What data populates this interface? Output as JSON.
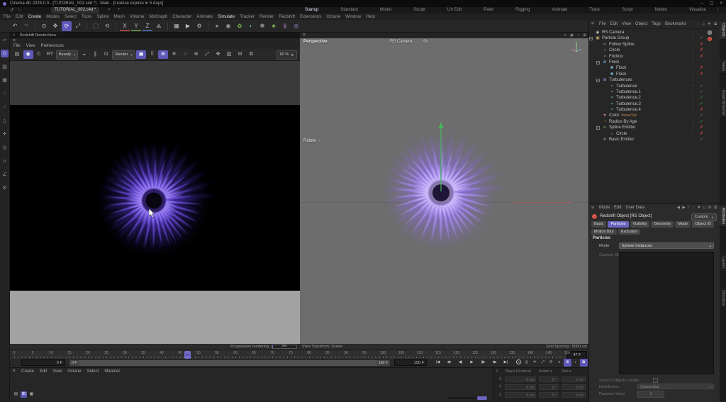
{
  "colors": {
    "accent": "#6c66c4",
    "check_green": "#4fae53",
    "cross_red": "#cf4a42",
    "rs_tag_red": "#c23c34",
    "viewport_gray": "#6d6d6d"
  },
  "window": {
    "title": "Cinema 4D 2025.0.0 - [TUTORIAL_002.c4d *] - Main - [License expires in 5 days]",
    "controls": [
      {
        "name": "minimize-button",
        "glyph": "–"
      },
      {
        "name": "maximize-button",
        "glyph": "▢"
      },
      {
        "name": "close-button",
        "glyph": "×"
      }
    ]
  },
  "document_bar": {
    "back": "↺",
    "forward": "↻",
    "tab_label": "TUTORIAL_002.c4d *",
    "tab_close": "×",
    "tab_add": "+",
    "overflow": "⋮"
  },
  "layout_tabs": {
    "active": "Startup",
    "items": [
      "Startup",
      "Standard",
      "Model",
      "Sculpt",
      "UV Edit",
      "Paint",
      "Rigging",
      "Animate",
      "Track",
      "Script",
      "Nodes",
      "Visualize"
    ]
  },
  "menu_bar": {
    "items": [
      "File",
      "Edit",
      "Create",
      "Modes",
      "Select",
      "Tools",
      "Spline",
      "Mesh",
      "Volume",
      "MoGraph",
      "Character",
      "Animate",
      "Simulate",
      "Tracker",
      "Render",
      "Redshift",
      "Extensions",
      "Octane",
      "Window",
      "Help"
    ],
    "emphasized": [
      "Create",
      "Simulate"
    ]
  },
  "main_toolbar": {
    "icons": [
      {
        "name": "undo-icon",
        "glyph": "↶"
      },
      {
        "name": "redo-icon",
        "glyph": "↷",
        "dim": true
      },
      {
        "sep": true
      },
      {
        "name": "live-selection-icon",
        "glyph": "⊙"
      },
      {
        "name": "move-icon",
        "glyph": "✥"
      },
      {
        "name": "rotate-icon",
        "glyph": "⟳",
        "active": true
      },
      {
        "name": "scale-icon",
        "glyph": "⤢"
      },
      {
        "sep": true
      },
      {
        "name": "last-tool-icon",
        "glyph": "◯",
        "dim": true
      },
      {
        "name": "coordinate-system-icon",
        "glyph": "⟲"
      },
      {
        "sep": true
      },
      {
        "name": "lock-x-axis-icon",
        "glyph": "X",
        "underline": "#c4504e"
      },
      {
        "name": "lock-y-axis-icon",
        "glyph": "Y",
        "underline": "#69a84f"
      },
      {
        "name": "lock-z-axis-icon",
        "glyph": "Z",
        "underline": "#5575c9"
      },
      {
        "name": "workplane-icon",
        "glyph": "⟁"
      },
      {
        "sep": true
      },
      {
        "name": "render-view-icon",
        "glyph": "▦"
      },
      {
        "name": "render-picture-viewer-icon",
        "glyph": "▶"
      },
      {
        "name": "render-settings-icon",
        "glyph": "⚙"
      },
      {
        "sep": true
      },
      {
        "name": "new-material-icon",
        "glyph": "●",
        "color": "#8f8f8f"
      },
      {
        "name": "edit-material-icon",
        "glyph": "◉",
        "color": "#9f9f9f"
      },
      {
        "name": "simulation-scene-icon",
        "glyph": "✿",
        "color": "#7cb24c"
      },
      {
        "name": "cloth-icon",
        "glyph": "◐",
        "color": "#58a87c"
      },
      {
        "name": "rigid-body-icon",
        "glyph": "✽",
        "color": "#9a9a9a"
      },
      {
        "name": "particles-icon",
        "glyph": "♣",
        "color": "#7cb24c"
      },
      {
        "name": "field-icon",
        "glyph": "ϕ",
        "color": "#b07cc9"
      },
      {
        "name": "volume-icon",
        "glyph": "◎",
        "color": "#8a9ad0"
      }
    ]
  },
  "left_toolbar": {
    "icons": [
      {
        "name": "make-editable-icon",
        "glyph": "▱"
      },
      {
        "name": "model-mode-icon",
        "glyph": "◇",
        "active": true
      },
      {
        "name": "texture-mode-icon",
        "glyph": "▨"
      },
      {
        "name": "workplane-mode-icon",
        "glyph": "▦"
      },
      {
        "name": "points-mode-icon",
        "glyph": "∴"
      },
      {
        "name": "edges-mode-icon",
        "glyph": "∕"
      },
      {
        "name": "polygons-mode-icon",
        "glyph": "△"
      },
      {
        "name": "enable-axis-icon",
        "glyph": "✛"
      },
      {
        "name": "viewport-solo-icon",
        "glyph": "◎"
      },
      {
        "name": "snap-icon",
        "glyph": "∪"
      },
      {
        "name": "quantize-icon",
        "glyph": "∠"
      },
      {
        "name": "modeling-settings-icon",
        "glyph": "⚙"
      }
    ]
  },
  "renderview": {
    "tab_close": "×",
    "title": "Redshift RenderView",
    "hamburger": "≡",
    "menus": [
      "File",
      "View",
      "Preferences"
    ],
    "icons": [
      {
        "name": "snapshot-icon",
        "glyph": "▤"
      },
      {
        "name": "camera-lock-icon",
        "glyph": "◉",
        "active": true
      },
      {
        "name": "restart-render-icon",
        "glyph": "C"
      },
      {
        "name": "rt-toggle",
        "glyph": "RT"
      },
      {
        "name": "aov-select",
        "dropdown": "Beauty"
      },
      {
        "name": "display-filter-icon",
        "glyph": "◒",
        "caret": true
      },
      {
        "name": "pause-icon",
        "glyph": "∥"
      },
      {
        "name": "region-icon",
        "glyph": "⊡"
      },
      {
        "name": "render-select",
        "dropdown": "Render"
      },
      {
        "name": "bucket-render-icon",
        "glyph": "▣",
        "active": true
      },
      {
        "name": "progressive-grid-icon",
        "glyph": "⠿"
      },
      {
        "name": "pixel-match-icon",
        "glyph": "⊞",
        "active": true
      },
      {
        "name": "freeze-icon",
        "glyph": "❄"
      },
      {
        "name": "background-icon",
        "glyph": "○",
        "caret": true
      },
      {
        "name": "focus-icon",
        "glyph": "⊕"
      },
      {
        "name": "fit-view-icon",
        "glyph": "⤢"
      },
      {
        "name": "pan-view-icon",
        "glyph": "✥"
      },
      {
        "name": "compare-icon",
        "glyph": "▥"
      },
      {
        "name": "save-image-icon",
        "glyph": "⊟"
      },
      {
        "name": "copy-image-icon",
        "glyph": "⧉"
      }
    ],
    "zoom_value": "60 %",
    "zoom_spin": "⇅"
  },
  "viewport": {
    "hamburger": "≡",
    "right_icons": [
      {
        "name": "display-mode-icon",
        "glyph": "◐"
      },
      {
        "name": "camera-icon",
        "glyph": "◉"
      },
      {
        "name": "view-history-icon",
        "glyph": "◔"
      },
      {
        "name": "quad-view-icon",
        "glyph": "⊞"
      }
    ],
    "view_label": "Perspective",
    "camera_label": "RS Camera",
    "camera_extra": "0s",
    "hud_tool": "Rotate",
    "hud_tool_icon": "○"
  },
  "scene": {
    "viewport_flower": {
      "outer": "#8468d8",
      "mid": "#a88ef0",
      "inner": "#cbbaf8",
      "core": "#181030",
      "petals": 34,
      "radius": 100
    },
    "render_flower": {
      "outer": "#3b28a0",
      "mid": "#6a4cdc",
      "inner": "#9b82f0",
      "core": "#06040c",
      "petals": 34,
      "radius": 96
    },
    "axis_arrow_color": "#45b85c"
  },
  "object_manager": {
    "hamburger": "≡",
    "menus": [
      "File",
      "Edit",
      "View",
      "Object",
      "Tags",
      "Bookmarks"
    ],
    "right_icons": [
      {
        "name": "search-icon",
        "glyph": "◌"
      },
      {
        "name": "home-icon",
        "glyph": "⌂"
      },
      {
        "name": "filter-icon",
        "glyph": "▼"
      },
      {
        "name": "popout-icon",
        "glyph": "⧉"
      }
    ],
    "items": [
      {
        "label": "RS Camera",
        "depth": 0,
        "glyph": "◉",
        "color": "#c8c8c8",
        "state": "",
        "tags": [
          "cam"
        ]
      },
      {
        "label": "Particle Group",
        "depth": 0,
        "glyph": "▣",
        "color": "#c8b06a",
        "expand": true,
        "state": "c",
        "tags": [
          "rs"
        ]
      },
      {
        "label": "Follow Spline",
        "depth": 1,
        "glyph": "∿",
        "color": "#d09ae0",
        "state": "x"
      },
      {
        "label": "Circle",
        "depth": 1,
        "glyph": "○",
        "color": "#b8b8b8",
        "state": "x"
      },
      {
        "label": "Friction",
        "depth": 1,
        "glyph": "≈",
        "color": "#e0a868",
        "state": "x"
      },
      {
        "label": "Flock",
        "depth": 1,
        "glyph": "⊞",
        "color": "#7fc0e8",
        "expand": true,
        "state": ""
      },
      {
        "label": "Flock",
        "depth": 2,
        "glyph": "✽",
        "color": "#7fc0e8",
        "state": "x"
      },
      {
        "label": "Flock",
        "depth": 2,
        "glyph": "✽",
        "color": "#7fc0e8",
        "state": "x"
      },
      {
        "label": "Turbulences",
        "depth": 1,
        "glyph": "⊞",
        "color": "#9a9ae0",
        "expand": true,
        "state": ""
      },
      {
        "label": "Turbulence",
        "depth": 2,
        "glyph": "≈",
        "color": "#7fd0e0",
        "state": "c"
      },
      {
        "label": "Turbulence.1",
        "depth": 2,
        "glyph": "≈",
        "color": "#7fd0e0",
        "state": "c"
      },
      {
        "label": "Turbulence.2",
        "depth": 2,
        "glyph": "≈",
        "color": "#7fd0e0",
        "state": "c"
      },
      {
        "label": "Turbulence.3",
        "depth": 2,
        "glyph": "≈",
        "color": "#7fd0e0",
        "state": "c"
      },
      {
        "label": "Turbulence.4",
        "depth": 2,
        "glyph": "≈",
        "color": "#7fd0e0",
        "state": "x"
      },
      {
        "label": "Color",
        "suffix": "Interp/Spl",
        "depth": 1,
        "glyph": "▼",
        "color": "#e07fb0",
        "state": "c"
      },
      {
        "label": "Radius By Age",
        "depth": 1,
        "glyph": "◔",
        "color": "#e0b060",
        "state": "c"
      },
      {
        "label": "Spline Emitter",
        "depth": 1,
        "glyph": "∿",
        "color": "#9ad870",
        "expand": true,
        "state": "x"
      },
      {
        "label": "Circle",
        "depth": 2,
        "glyph": "○",
        "color": "#b8b8b8",
        "state": "x"
      },
      {
        "label": "Basic Emitter",
        "depth": 1,
        "glyph": "✛",
        "color": "#b8b8b8",
        "state": "c"
      }
    ]
  },
  "attribute_manager": {
    "hamburger": "≡",
    "menus": [
      "Mode",
      "Edit",
      "User Data"
    ],
    "right_icons": [
      {
        "name": "back-icon",
        "glyph": "◀"
      },
      {
        "name": "forward-icon",
        "glyph": "▶"
      },
      {
        "name": "up-icon",
        "glyph": "↑"
      },
      {
        "name": "search-icon",
        "glyph": "◌"
      },
      {
        "name": "filter-icon",
        "glyph": "▼"
      },
      {
        "name": "lock-icon",
        "glyph": "▯"
      },
      {
        "name": "settings-icon",
        "glyph": "⚙"
      },
      {
        "name": "popout-icon",
        "glyph": "⧉"
      }
    ],
    "object_title": "Redshift Object [RS Object]",
    "preset_dropdown": "Custom",
    "tabs": {
      "active": "Particles",
      "items": [
        "Basic",
        "Particles",
        "Visibility",
        "Geometry",
        "Matte",
        "Object ID",
        "Motion Blur",
        "Exclusion"
      ]
    },
    "section_title": "Particles",
    "fields": {
      "mode_label": "Mode",
      "mode_value": "Sphere Instances",
      "custom_objects_label": "Custom Objects",
      "source_visible_label": "Source Objects Visible",
      "distribution_label": "Distribution",
      "distribution_value": "Sequential",
      "random_seed_label": "Random Seed",
      "random_seed_value": "1"
    }
  },
  "side_tabs": {
    "top": {
      "active": "Objects",
      "items": [
        "Objects",
        "Takes",
        "Asset Browser"
      ]
    },
    "bottom": {
      "active": "Attributes",
      "items": [
        "Attributes",
        "Layers",
        "Structure"
      ]
    }
  },
  "status_bar": {
    "progressive_label": "Progressive rendering",
    "progressive_value": "2%",
    "progressive_fraction": 0.02,
    "view_transform": "View Transform: Scene",
    "grid_spacing": "Grid Spacing : 5000 cm"
  },
  "timeline": {
    "tick_labels": [
      0,
      5,
      10,
      15,
      20,
      25,
      30,
      35,
      40,
      45,
      50,
      55,
      60,
      65,
      70,
      75,
      80,
      85,
      90,
      95,
      100,
      105,
      110,
      115,
      120,
      125,
      130,
      135,
      140,
      145,
      150
    ],
    "frame_max": 150,
    "playhead_frame": 47,
    "playhead_label": "47",
    "current_frame": "47 F",
    "start_field": "0 F",
    "range_start": "0 F",
    "range_end": "150 F",
    "end_field": "150 F",
    "buttons": [
      {
        "name": "goto-start-button",
        "glyph": "|◀"
      },
      {
        "name": "prev-key-button",
        "glyph": "◀•"
      },
      {
        "name": "prev-frame-button",
        "glyph": "◀|"
      },
      {
        "name": "play-button",
        "glyph": "▶"
      },
      {
        "name": "next-frame-button",
        "glyph": "|▶"
      },
      {
        "name": "next-key-button",
        "glyph": "•▶"
      },
      {
        "name": "goto-end-button",
        "glyph": "▶|"
      }
    ],
    "record_icons": [
      {
        "name": "autokey-icon",
        "glyph": "A",
        "circled": true
      },
      {
        "name": "record-keyframe-icon",
        "glyph": "◎"
      },
      {
        "name": "record-position-icon",
        "glyph": "✛"
      },
      {
        "name": "record-scale-icon",
        "glyph": "⤢"
      },
      {
        "name": "record-rotation-icon",
        "glyph": "⟳"
      },
      {
        "name": "record-parameter-icon",
        "glyph": "≡"
      },
      {
        "name": "record-pla-icon",
        "glyph": "⊞",
        "active": true
      },
      {
        "name": "sound-icon",
        "glyph": "♪"
      },
      {
        "name": "keyframe-selection-icon",
        "glyph": "⧉",
        "active": true
      }
    ]
  },
  "materials_panel": {
    "hamburger": "≡",
    "menus": [
      "Create",
      "Edit",
      "View",
      "Octane",
      "Select",
      "Material"
    ],
    "view_icons": [
      {
        "name": "material-list-view-icon",
        "glyph": "▤"
      },
      {
        "name": "material-grid-view-icon",
        "glyph": "⊞",
        "active": true
      },
      {
        "name": "material-large-view-icon",
        "glyph": "▣"
      }
    ]
  },
  "coordinates_panel": {
    "hamburger": "≡",
    "columns": [
      "Object (Relative)",
      "Rotate",
      "Size"
    ],
    "rows": [
      {
        "axis": "X",
        "v1": "0 cm",
        "v2": "0 °",
        "v3": "0 cm"
      },
      {
        "axis": "Y",
        "v1": "0 cm",
        "v2": "0 °",
        "v3": "0 cm"
      },
      {
        "axis": "Z",
        "v1": "0 cm",
        "v2": "0 °",
        "v3": "0 cm"
      }
    ]
  }
}
